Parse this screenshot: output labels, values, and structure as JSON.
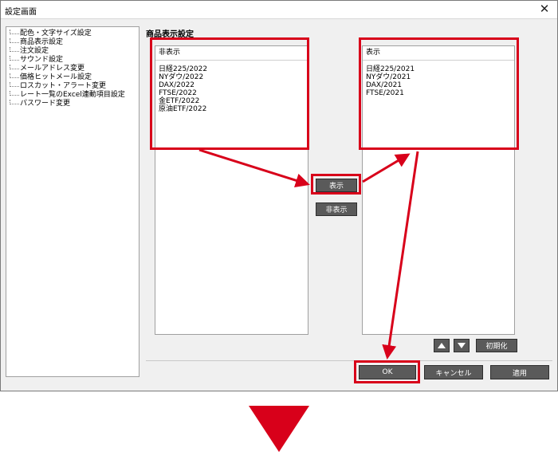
{
  "window": {
    "title": "設定画面",
    "close_glyph": "✕"
  },
  "sidebar": {
    "items": [
      {
        "label": "配色・文字サイズ設定"
      },
      {
        "label": "商品表示設定"
      },
      {
        "label": "注文設定"
      },
      {
        "label": "サウンド設定"
      },
      {
        "label": "メールアドレス変更"
      },
      {
        "label": "価格ヒットメール設定"
      },
      {
        "label": "ロスカット・アラート変更"
      },
      {
        "label": "レート一覧のExcel連動項目設定"
      },
      {
        "label": "パスワード変更"
      }
    ]
  },
  "main": {
    "section_title": "商品表示設定",
    "hidden_list": {
      "header": "非表示",
      "items": [
        "日経225/2022",
        "NYダウ/2022",
        "DAX/2022",
        "FTSE/2022",
        "金ETF/2022",
        "原油ETF/2022"
      ]
    },
    "shown_list": {
      "header": "表示",
      "items": [
        "日経225/2021",
        "NYダウ/2021",
        "DAX/2021",
        "FTSE/2021"
      ]
    },
    "show_button": "表示",
    "hide_button": "非表示",
    "move_up_icon": "arrow-up",
    "move_down_icon": "arrow-down",
    "reset_button": "初期化"
  },
  "footer": {
    "ok": "OK",
    "cancel": "キャンセル",
    "apply": "適用"
  },
  "colors": {
    "highlight": "#d8001a",
    "dark_button": "#5a5a5a"
  }
}
